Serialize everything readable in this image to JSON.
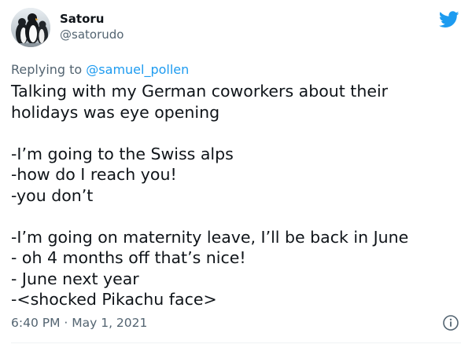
{
  "author": {
    "display_name": "Satoru",
    "handle": "@satorudo",
    "avatar_icon": "penguins-avatar"
  },
  "brand": {
    "icon": "twitter-bird-icon",
    "color": "#1d9bf0"
  },
  "reply": {
    "prefix": "Replying to ",
    "handle": "@samuel_pollen"
  },
  "body": {
    "lines": [
      "Talking with my German coworkers about their",
      "holidays was eye opening",
      "",
      "-I’m going to the Swiss alps",
      "-how do I reach you!",
      "-you don’t",
      "",
      "-I’m going on maternity leave, I’ll be back in June",
      "- oh 4 months off that’s nice!",
      "- June next year",
      "-<shocked Pikachu face>"
    ]
  },
  "footer": {
    "timestamp": "6:40 PM · May 1, 2021",
    "info_icon": "info-icon"
  },
  "colors": {
    "text": "#0f1419",
    "muted": "#536471",
    "link": "#1d9bf0"
  }
}
